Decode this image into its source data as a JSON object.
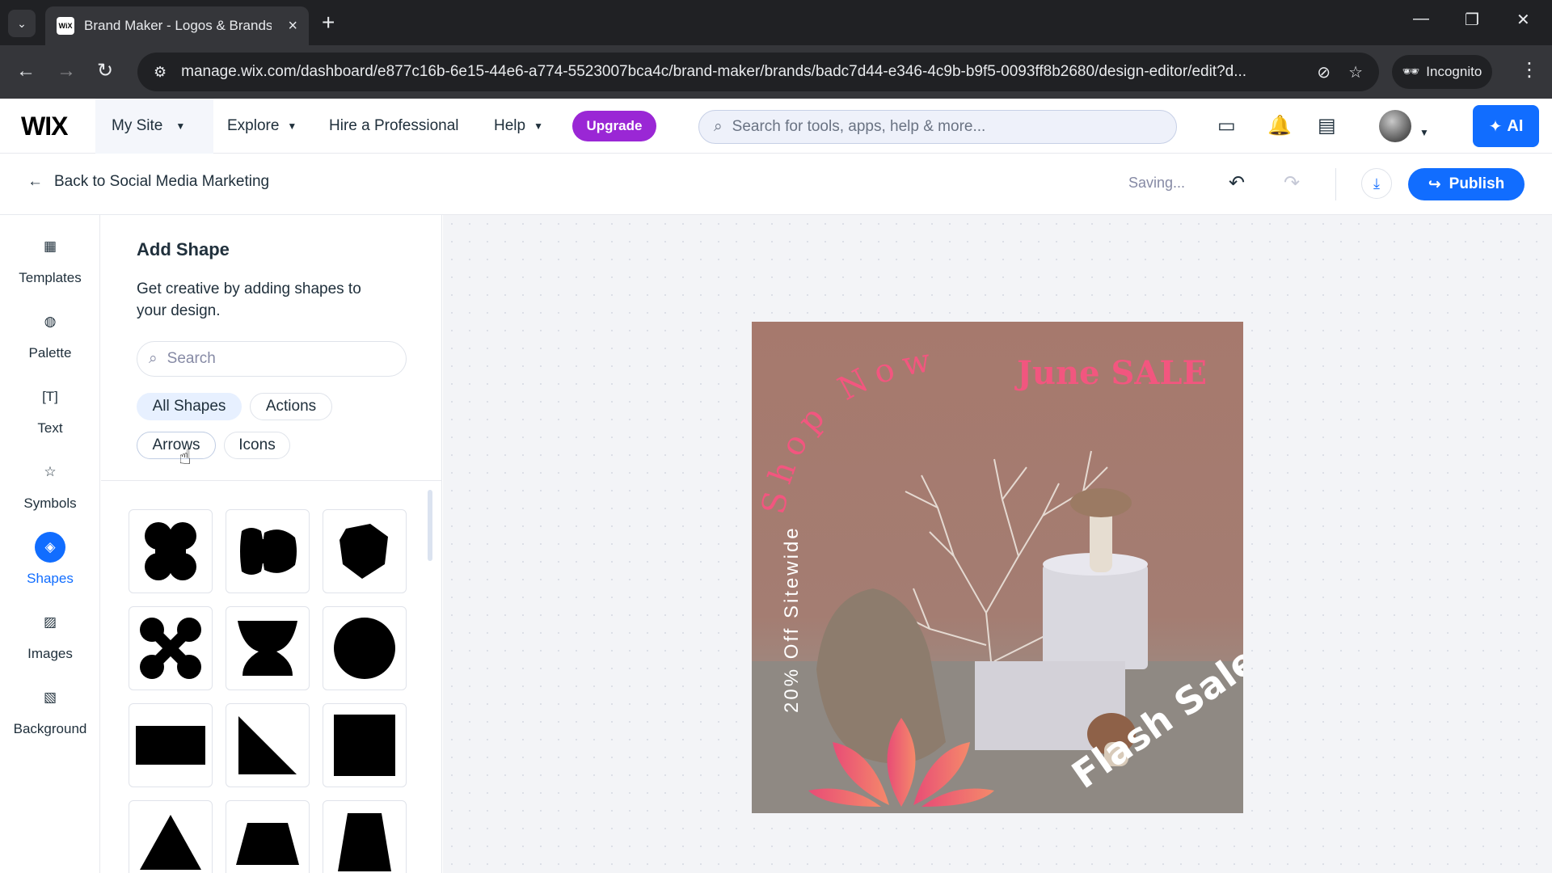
{
  "browser": {
    "tab_title": "Brand Maker - Logos & Brands",
    "favicon_text": "WiX",
    "url": "manage.wix.com/dashboard/e877c16b-6e15-44e6-a774-5523007bca4c/brand-maker/brands/badc7d44-e346-4c9b-b9f5-0093ff8b2680/design-editor/edit?d...",
    "incognito_label": "Incognito"
  },
  "header": {
    "logo": "WIX",
    "site_menu": "My Site",
    "explore": "Explore",
    "hire": "Hire a Professional",
    "help": "Help",
    "upgrade": "Upgrade",
    "search_placeholder": "Search for tools, apps, help & more...",
    "ai_label": "AI"
  },
  "editor_bar": {
    "back_label": "Back to Social Media Marketing",
    "status": "Saving...",
    "publish": "Publish"
  },
  "rail": {
    "items": [
      {
        "label": "Templates",
        "icon": "templates-icon"
      },
      {
        "label": "Palette",
        "icon": "palette-icon"
      },
      {
        "label": "Text",
        "icon": "text-icon"
      },
      {
        "label": "Symbols",
        "icon": "star-icon"
      },
      {
        "label": "Shapes",
        "icon": "shapes-icon",
        "active": true
      },
      {
        "label": "Images",
        "icon": "image-icon"
      },
      {
        "label": "Background",
        "icon": "background-icon"
      }
    ]
  },
  "panel": {
    "title": "Add Shape",
    "description": "Get creative by adding shapes to your design.",
    "search_placeholder": "Search",
    "filters": [
      {
        "label": "All Shapes",
        "active": true
      },
      {
        "label": "Actions"
      },
      {
        "label": "Arrows"
      },
      {
        "label": "Icons"
      }
    ],
    "shapes": [
      "blob-quatrefoil",
      "rounded-pair",
      "irregular-polygon",
      "cross-blob",
      "goblet",
      "circle",
      "rectangle",
      "right-triangle",
      "square",
      "triangle",
      "trapezoid",
      "tall-trapezoid"
    ]
  },
  "design": {
    "headline": "June SALE",
    "arc_text": "Shop Now",
    "side_text": "20% Off Sitewide",
    "corner_text": "Flash Sale",
    "colors": {
      "pink": "#f2567f",
      "background": "#a6796d",
      "white": "#ffffff"
    }
  },
  "colors": {
    "accent": "#116dff",
    "upgrade": "#9a27d5",
    "chip_active": "#e7f0ff"
  }
}
